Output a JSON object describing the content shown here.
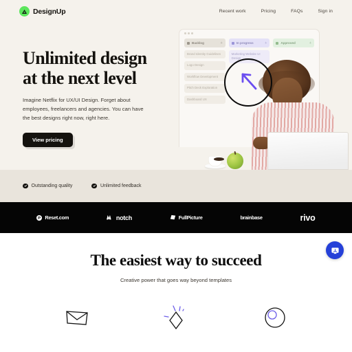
{
  "nav": {
    "brand_name": "DesignUp",
    "brand_logo_icon": "mountain-logo-icon",
    "brand_logo_color": "#5ce65c",
    "links": [
      {
        "label": "Recent work"
      },
      {
        "label": "Pricing"
      },
      {
        "label": "FAQs"
      },
      {
        "label": "Sign in"
      }
    ]
  },
  "hero": {
    "title_line1": "Unlimited design",
    "title_line2": "at the next level",
    "subtitle": "Imagine Netflix for UX/UI Design. Forget about employees, freelancers and agencies. You can have the best designs right now, right here.",
    "cta_label": "View pricing",
    "background_color": "#f5f2ec",
    "board": {
      "columns": [
        {
          "title": "Backlog",
          "add_label": "+",
          "color": "#e6e2da",
          "cards": [
            "Brand Identity Guidelines",
            "Logo Design",
            "Workflow Development",
            "Pitch Deck Exploration",
            "Dashboard UX"
          ]
        },
        {
          "title": "In progress",
          "add_label": "+",
          "color": "#e4e1f7",
          "cards": [
            "Marketing Website UI Design"
          ]
        },
        {
          "title": "Approved",
          "add_label": "+",
          "color": "#e2f0e0",
          "cards": []
        }
      ]
    }
  },
  "badges": {
    "background_color": "#e9e4dc",
    "items": [
      {
        "label": "Outstanding quality",
        "icon": "check-circle-icon"
      },
      {
        "label": "Unlimited feedback",
        "icon": "check-circle-icon"
      }
    ]
  },
  "logo_strip": {
    "background_color": "#050505",
    "logos": [
      {
        "name": "Reset.com",
        "mark": "reset-circle-icon"
      },
      {
        "name": "notch",
        "mark": "notch-mark-icon"
      },
      {
        "name": "FullPicture",
        "mark": "fullpicture-flag-icon"
      },
      {
        "name": "brainbase",
        "mark": "none"
      },
      {
        "name": "rivo",
        "mark": "none"
      }
    ]
  },
  "bottom": {
    "title": "The easiest way to succeed",
    "subtitle": "Creative power that goes way beyond templates",
    "feature_icons": [
      {
        "icon": "envelope-icon"
      },
      {
        "icon": "sparkle-diamond-icon"
      },
      {
        "icon": "circles-icon"
      }
    ]
  },
  "chat_widget": {
    "icon": "chat-bubble-icon",
    "color": "#2540d8"
  }
}
